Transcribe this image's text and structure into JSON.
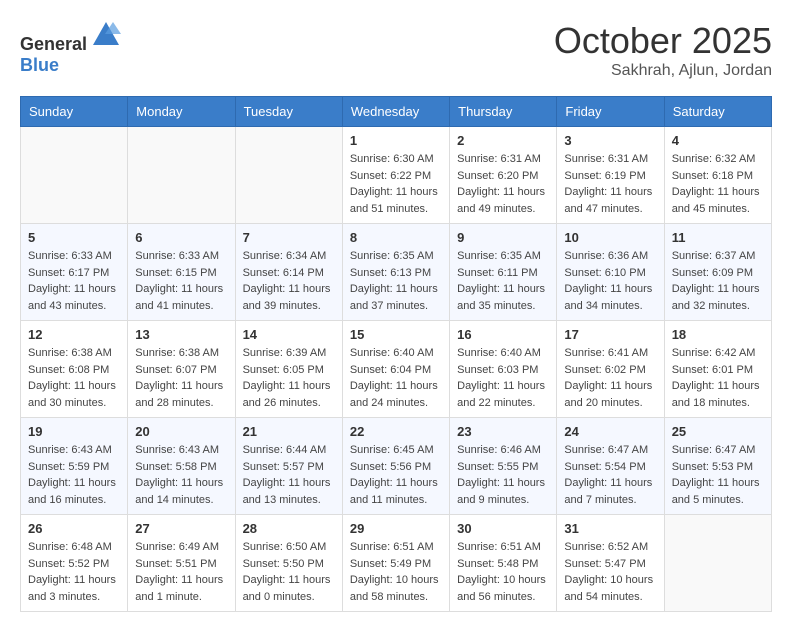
{
  "header": {
    "logo_general": "General",
    "logo_blue": "Blue",
    "month": "October 2025",
    "location": "Sakhrah, Ajlun, Jordan"
  },
  "weekdays": [
    "Sunday",
    "Monday",
    "Tuesday",
    "Wednesday",
    "Thursday",
    "Friday",
    "Saturday"
  ],
  "weeks": [
    [
      {
        "day": "",
        "sunrise": "",
        "sunset": "",
        "daylight": ""
      },
      {
        "day": "",
        "sunrise": "",
        "sunset": "",
        "daylight": ""
      },
      {
        "day": "",
        "sunrise": "",
        "sunset": "",
        "daylight": ""
      },
      {
        "day": "1",
        "sunrise": "Sunrise: 6:30 AM",
        "sunset": "Sunset: 6:22 PM",
        "daylight": "Daylight: 11 hours and 51 minutes."
      },
      {
        "day": "2",
        "sunrise": "Sunrise: 6:31 AM",
        "sunset": "Sunset: 6:20 PM",
        "daylight": "Daylight: 11 hours and 49 minutes."
      },
      {
        "day": "3",
        "sunrise": "Sunrise: 6:31 AM",
        "sunset": "Sunset: 6:19 PM",
        "daylight": "Daylight: 11 hours and 47 minutes."
      },
      {
        "day": "4",
        "sunrise": "Sunrise: 6:32 AM",
        "sunset": "Sunset: 6:18 PM",
        "daylight": "Daylight: 11 hours and 45 minutes."
      }
    ],
    [
      {
        "day": "5",
        "sunrise": "Sunrise: 6:33 AM",
        "sunset": "Sunset: 6:17 PM",
        "daylight": "Daylight: 11 hours and 43 minutes."
      },
      {
        "day": "6",
        "sunrise": "Sunrise: 6:33 AM",
        "sunset": "Sunset: 6:15 PM",
        "daylight": "Daylight: 11 hours and 41 minutes."
      },
      {
        "day": "7",
        "sunrise": "Sunrise: 6:34 AM",
        "sunset": "Sunset: 6:14 PM",
        "daylight": "Daylight: 11 hours and 39 minutes."
      },
      {
        "day": "8",
        "sunrise": "Sunrise: 6:35 AM",
        "sunset": "Sunset: 6:13 PM",
        "daylight": "Daylight: 11 hours and 37 minutes."
      },
      {
        "day": "9",
        "sunrise": "Sunrise: 6:35 AM",
        "sunset": "Sunset: 6:11 PM",
        "daylight": "Daylight: 11 hours and 35 minutes."
      },
      {
        "day": "10",
        "sunrise": "Sunrise: 6:36 AM",
        "sunset": "Sunset: 6:10 PM",
        "daylight": "Daylight: 11 hours and 34 minutes."
      },
      {
        "day": "11",
        "sunrise": "Sunrise: 6:37 AM",
        "sunset": "Sunset: 6:09 PM",
        "daylight": "Daylight: 11 hours and 32 minutes."
      }
    ],
    [
      {
        "day": "12",
        "sunrise": "Sunrise: 6:38 AM",
        "sunset": "Sunset: 6:08 PM",
        "daylight": "Daylight: 11 hours and 30 minutes."
      },
      {
        "day": "13",
        "sunrise": "Sunrise: 6:38 AM",
        "sunset": "Sunset: 6:07 PM",
        "daylight": "Daylight: 11 hours and 28 minutes."
      },
      {
        "day": "14",
        "sunrise": "Sunrise: 6:39 AM",
        "sunset": "Sunset: 6:05 PM",
        "daylight": "Daylight: 11 hours and 26 minutes."
      },
      {
        "day": "15",
        "sunrise": "Sunrise: 6:40 AM",
        "sunset": "Sunset: 6:04 PM",
        "daylight": "Daylight: 11 hours and 24 minutes."
      },
      {
        "day": "16",
        "sunrise": "Sunrise: 6:40 AM",
        "sunset": "Sunset: 6:03 PM",
        "daylight": "Daylight: 11 hours and 22 minutes."
      },
      {
        "day": "17",
        "sunrise": "Sunrise: 6:41 AM",
        "sunset": "Sunset: 6:02 PM",
        "daylight": "Daylight: 11 hours and 20 minutes."
      },
      {
        "day": "18",
        "sunrise": "Sunrise: 6:42 AM",
        "sunset": "Sunset: 6:01 PM",
        "daylight": "Daylight: 11 hours and 18 minutes."
      }
    ],
    [
      {
        "day": "19",
        "sunrise": "Sunrise: 6:43 AM",
        "sunset": "Sunset: 5:59 PM",
        "daylight": "Daylight: 11 hours and 16 minutes."
      },
      {
        "day": "20",
        "sunrise": "Sunrise: 6:43 AM",
        "sunset": "Sunset: 5:58 PM",
        "daylight": "Daylight: 11 hours and 14 minutes."
      },
      {
        "day": "21",
        "sunrise": "Sunrise: 6:44 AM",
        "sunset": "Sunset: 5:57 PM",
        "daylight": "Daylight: 11 hours and 13 minutes."
      },
      {
        "day": "22",
        "sunrise": "Sunrise: 6:45 AM",
        "sunset": "Sunset: 5:56 PM",
        "daylight": "Daylight: 11 hours and 11 minutes."
      },
      {
        "day": "23",
        "sunrise": "Sunrise: 6:46 AM",
        "sunset": "Sunset: 5:55 PM",
        "daylight": "Daylight: 11 hours and 9 minutes."
      },
      {
        "day": "24",
        "sunrise": "Sunrise: 6:47 AM",
        "sunset": "Sunset: 5:54 PM",
        "daylight": "Daylight: 11 hours and 7 minutes."
      },
      {
        "day": "25",
        "sunrise": "Sunrise: 6:47 AM",
        "sunset": "Sunset: 5:53 PM",
        "daylight": "Daylight: 11 hours and 5 minutes."
      }
    ],
    [
      {
        "day": "26",
        "sunrise": "Sunrise: 6:48 AM",
        "sunset": "Sunset: 5:52 PM",
        "daylight": "Daylight: 11 hours and 3 minutes."
      },
      {
        "day": "27",
        "sunrise": "Sunrise: 6:49 AM",
        "sunset": "Sunset: 5:51 PM",
        "daylight": "Daylight: 11 hours and 1 minute."
      },
      {
        "day": "28",
        "sunrise": "Sunrise: 6:50 AM",
        "sunset": "Sunset: 5:50 PM",
        "daylight": "Daylight: 11 hours and 0 minutes."
      },
      {
        "day": "29",
        "sunrise": "Sunrise: 6:51 AM",
        "sunset": "Sunset: 5:49 PM",
        "daylight": "Daylight: 10 hours and 58 minutes."
      },
      {
        "day": "30",
        "sunrise": "Sunrise: 6:51 AM",
        "sunset": "Sunset: 5:48 PM",
        "daylight": "Daylight: 10 hours and 56 minutes."
      },
      {
        "day": "31",
        "sunrise": "Sunrise: 6:52 AM",
        "sunset": "Sunset: 5:47 PM",
        "daylight": "Daylight: 10 hours and 54 minutes."
      },
      {
        "day": "",
        "sunrise": "",
        "sunset": "",
        "daylight": ""
      }
    ]
  ]
}
